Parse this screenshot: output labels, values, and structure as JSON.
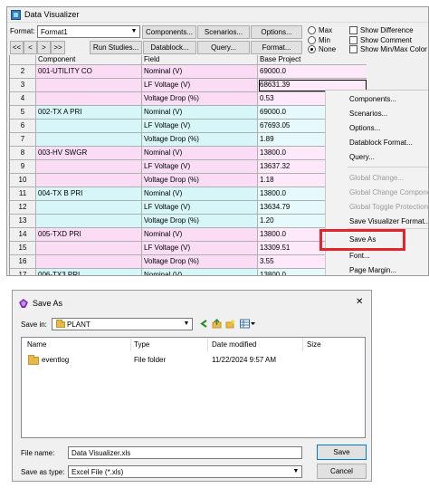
{
  "visualizer": {
    "title": "Data Visualizer",
    "format_label": "Format:",
    "format_value": "Format1",
    "buttons": {
      "components": "Components...",
      "scenarios": "Scenarios...",
      "options": "Options...",
      "run_studies": "Run Studies...",
      "datablock": "Datablock...",
      "query": "Query...",
      "format": "Format..."
    },
    "nav": [
      "<<",
      "<",
      ">",
      ">>"
    ],
    "radios": [
      {
        "label": "Max",
        "selected": false
      },
      {
        "label": "Min",
        "selected": false
      },
      {
        "label": "None",
        "selected": true
      }
    ],
    "checks": [
      {
        "label": "Show Difference",
        "checked": false
      },
      {
        "label": "Show Comment",
        "checked": false
      },
      {
        "label": "Show Min/Max Color",
        "checked": false
      }
    ],
    "grid": {
      "headers": [
        "Component",
        "Field",
        "Base Project"
      ],
      "rows": [
        {
          "num": "2",
          "component": "001-UTILITY CO",
          "field": "Nominal (V)",
          "value": "69000.0",
          "color": "pink"
        },
        {
          "num": "3",
          "component": "",
          "field": "LF Voltage (V)",
          "value": "68631.39",
          "color": "pink"
        },
        {
          "num": "4",
          "component": "",
          "field": "Voltage Drop (%)",
          "value": "0.53",
          "color": "pink"
        },
        {
          "num": "5",
          "component": "002-TX A PRI",
          "field": "Nominal (V)",
          "value": "69000.0",
          "color": "cyan"
        },
        {
          "num": "6",
          "component": "",
          "field": "LF Voltage (V)",
          "value": "67693.05",
          "color": "cyan"
        },
        {
          "num": "7",
          "component": "",
          "field": "Voltage Drop (%)",
          "value": "1.89",
          "color": "cyan"
        },
        {
          "num": "8",
          "component": "003-HV SWGR",
          "field": "Nominal (V)",
          "value": "13800.0",
          "color": "pink"
        },
        {
          "num": "9",
          "component": "",
          "field": "LF Voltage (V)",
          "value": "13637.32",
          "color": "pink"
        },
        {
          "num": "10",
          "component": "",
          "field": "Voltage Drop (%)",
          "value": "1.18",
          "color": "pink"
        },
        {
          "num": "11",
          "component": "004-TX B PRI",
          "field": "Nominal (V)",
          "value": "13800.0",
          "color": "cyan"
        },
        {
          "num": "12",
          "component": "",
          "field": "LF Voltage (V)",
          "value": "13634.79",
          "color": "cyan"
        },
        {
          "num": "13",
          "component": "",
          "field": "Voltage Drop (%)",
          "value": "1.20",
          "color": "cyan"
        },
        {
          "num": "14",
          "component": "005-TXD PRI",
          "field": "Nominal (V)",
          "value": "13800.0",
          "color": "pink"
        },
        {
          "num": "15",
          "component": "",
          "field": "LF Voltage (V)",
          "value": "13309.51",
          "color": "pink"
        },
        {
          "num": "16",
          "component": "",
          "field": "Voltage Drop (%)",
          "value": "3.55",
          "color": "pink"
        },
        {
          "num": "17",
          "component": "006-TX3 PRI",
          "field": "Nominal (V)",
          "value": "13800.0",
          "color": "cyan"
        }
      ]
    }
  },
  "context_menu": {
    "items": [
      {
        "label": "Components...",
        "enabled": true
      },
      {
        "label": "Scenarios...",
        "enabled": true
      },
      {
        "label": "Options...",
        "enabled": true
      },
      {
        "label": "Datablock Format...",
        "enabled": true
      },
      {
        "label": "Query...",
        "enabled": true
      },
      {
        "label": "Global Change...",
        "enabled": false
      },
      {
        "label": "Global Change Compone",
        "enabled": false
      },
      {
        "label": "Global Toggle Protection",
        "enabled": false
      },
      {
        "label": "Save Visualizer Format...",
        "enabled": true
      },
      {
        "label": "Save As",
        "enabled": true
      },
      {
        "label": "Font...",
        "enabled": true
      },
      {
        "label": "Page Margin...",
        "enabled": true
      }
    ],
    "highlight_color": "#e2252b"
  },
  "save_dialog": {
    "title": "Save As",
    "save_in_label": "Save in:",
    "save_in_value": "PLANT",
    "columns": [
      "Name",
      "Type",
      "Date modified",
      "Size"
    ],
    "files": [
      {
        "name": "eventlog",
        "type": "File folder",
        "date": "11/22/2024 9:57 AM",
        "size": ""
      }
    ],
    "file_name_label": "File name:",
    "file_name_value": "Data Visualizer.xls",
    "save_type_label": "Save as type:",
    "save_type_value": "Excel File (*.xls)",
    "save_button": "Save",
    "cancel_button": "Cancel",
    "close_glyph": "✕"
  }
}
